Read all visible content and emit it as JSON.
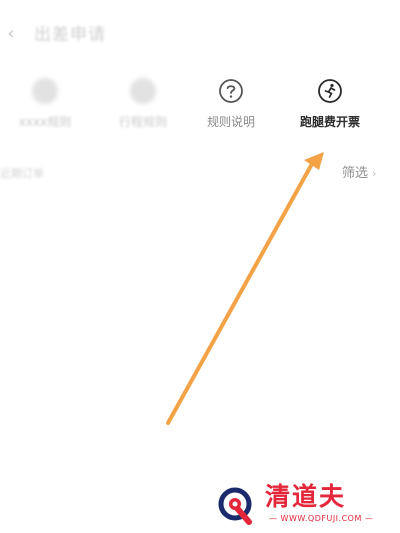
{
  "header": {
    "back_icon": "chevron-left-icon",
    "title": "出差申请"
  },
  "actions": [
    {
      "label": "xxxx规则",
      "icon": "blurred-icon",
      "blurred": true
    },
    {
      "label": "行程规则",
      "icon": "blurred-icon",
      "blurred": true
    },
    {
      "label": "规则说明",
      "icon": "question-circle-icon",
      "blurred": false
    },
    {
      "label": "跑腿费开票",
      "icon": "runner-circle-icon",
      "blurred": false
    }
  ],
  "list_header": {
    "subtitle": "近期订单",
    "filter_label": "筛选",
    "filter_icon": "chevron-right-icon"
  },
  "annotation": {
    "arrow_color": "#f4a246",
    "points_to": "跑腿费开票"
  },
  "watermark": {
    "brand": "清道夫",
    "url": "— WWW.QDFUJI.COM —",
    "color": "#e4263a"
  }
}
